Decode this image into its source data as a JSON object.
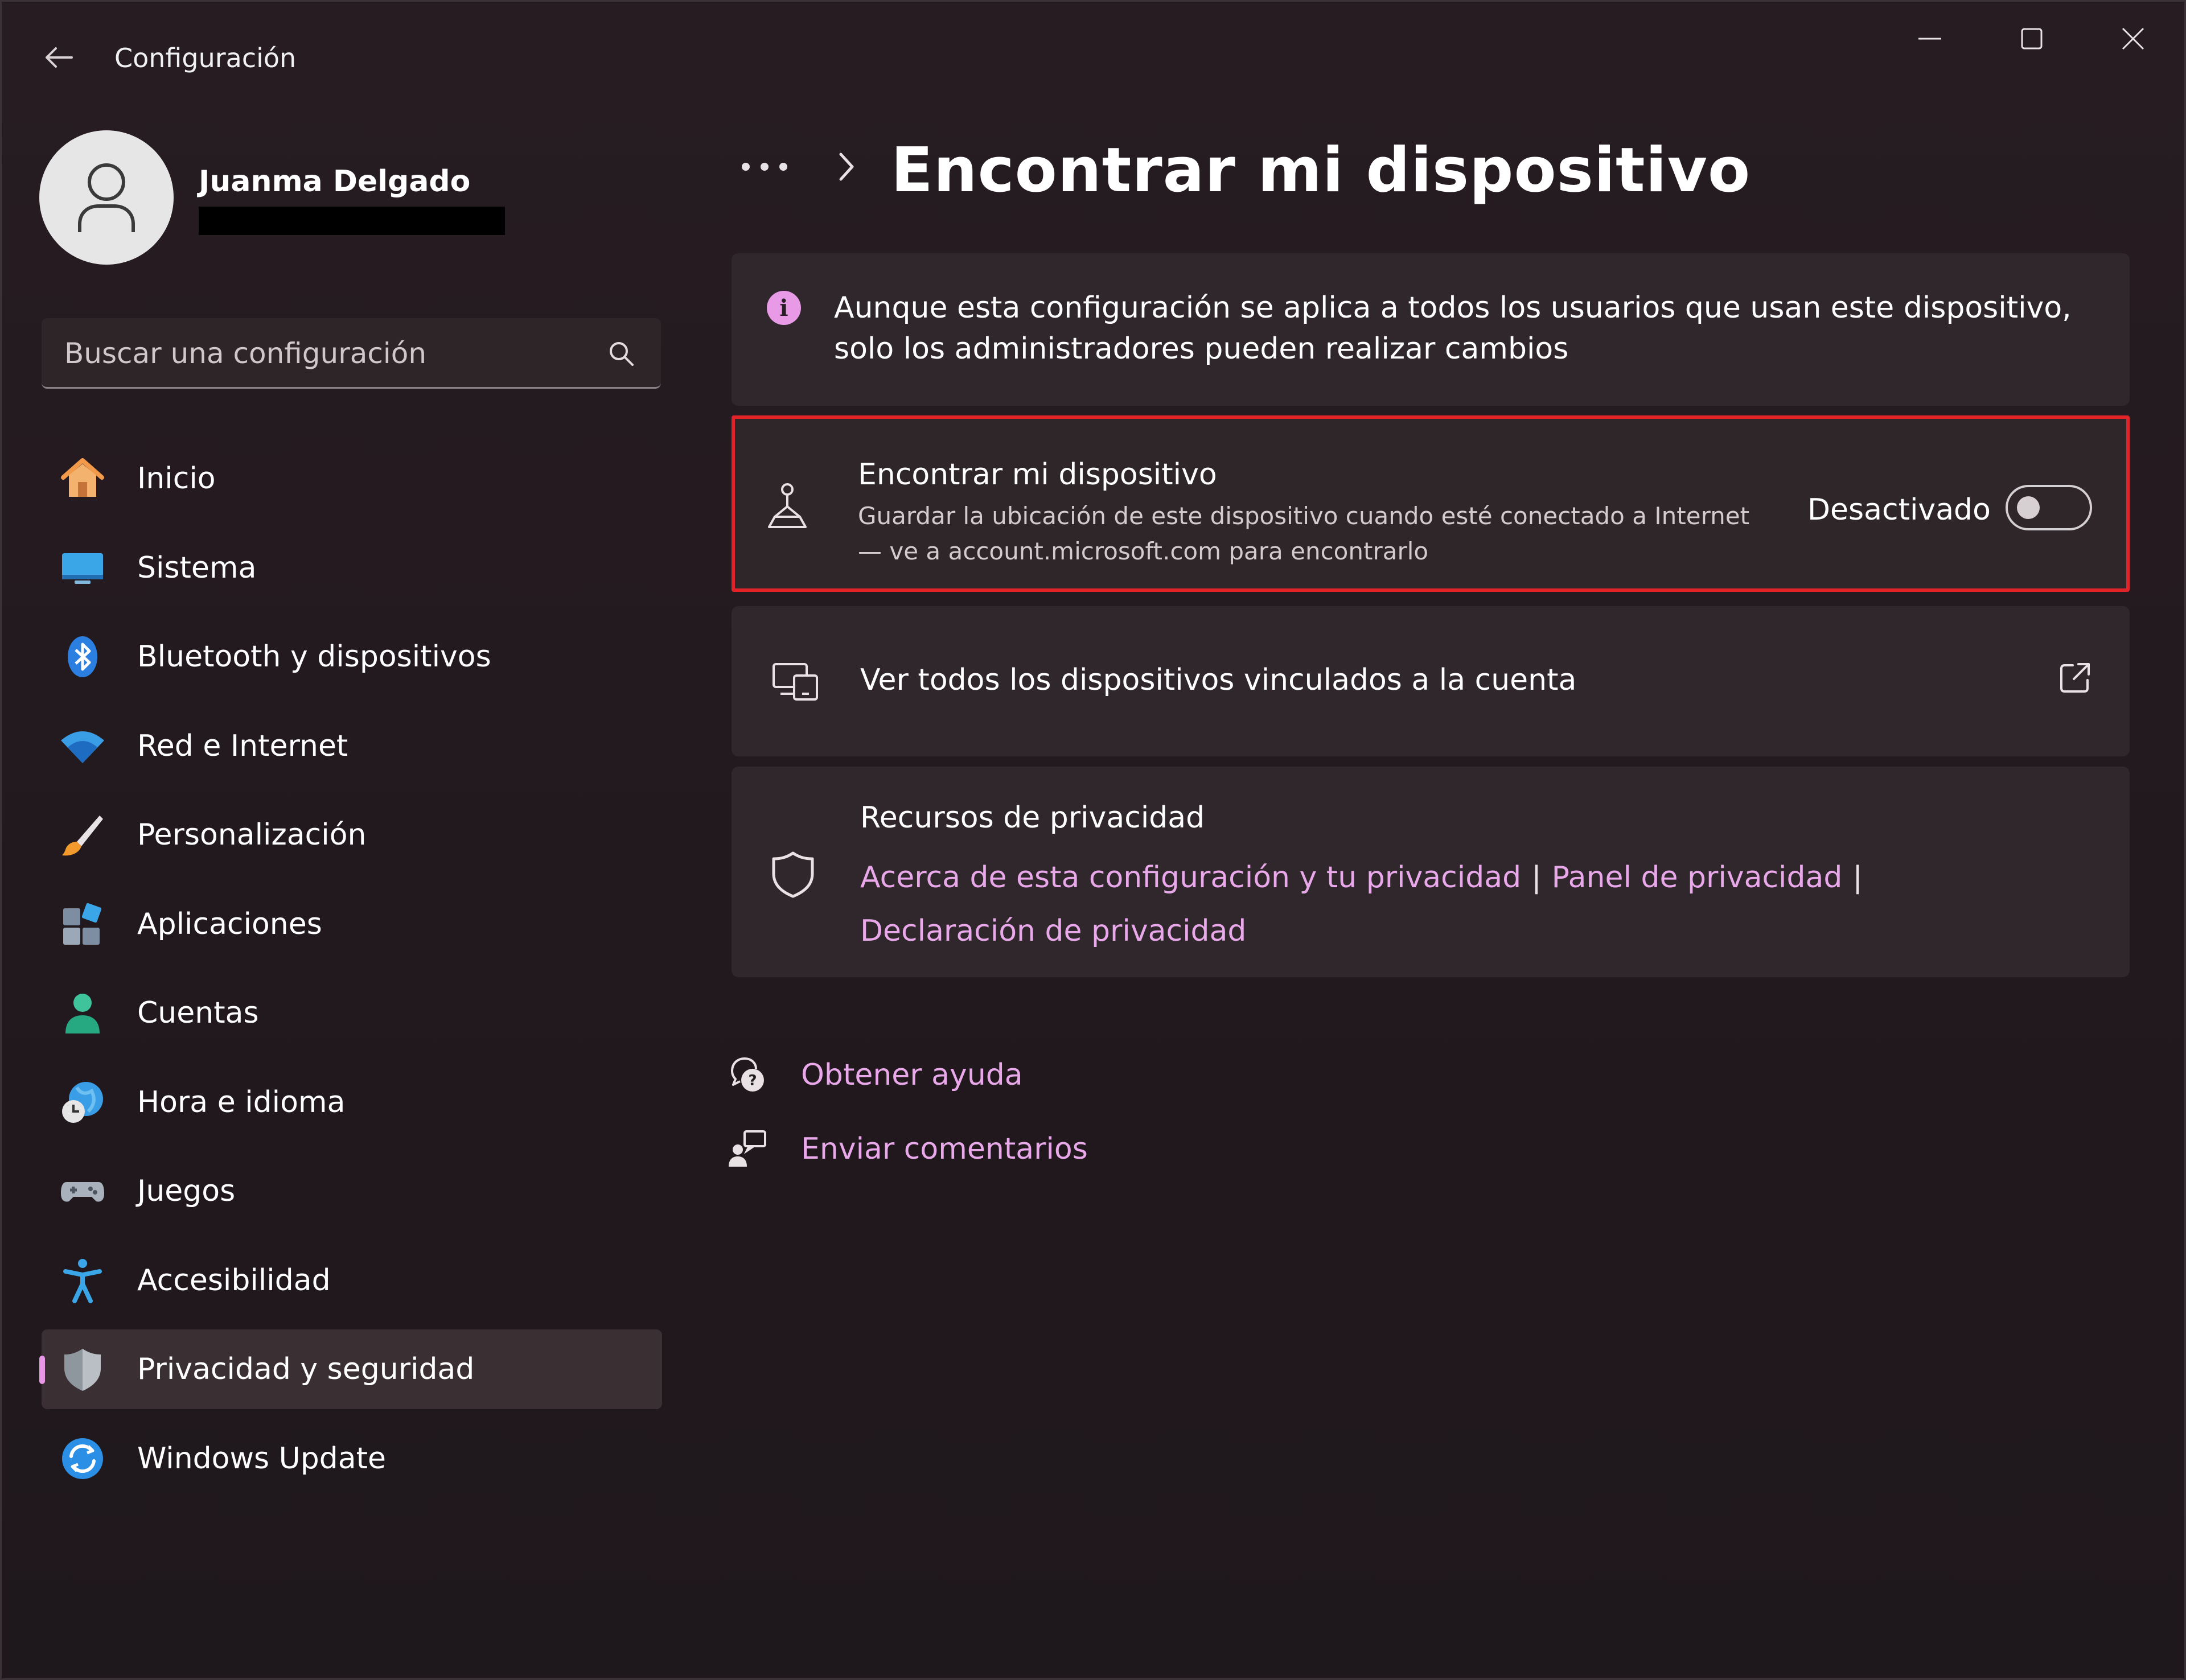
{
  "window": {
    "title": "Configuración",
    "controls": [
      "minimize",
      "maximize",
      "close"
    ]
  },
  "profile": {
    "name": "Juanma Delgado"
  },
  "search": {
    "placeholder": "Buscar una configuración"
  },
  "sidebar": {
    "items": [
      {
        "label": "Inicio",
        "icon": "home-icon"
      },
      {
        "label": "Sistema",
        "icon": "monitor-icon"
      },
      {
        "label": "Bluetooth y dispositivos",
        "icon": "bluetooth-icon"
      },
      {
        "label": "Red e Internet",
        "icon": "wifi-icon"
      },
      {
        "label": "Personalización",
        "icon": "brush-icon"
      },
      {
        "label": "Aplicaciones",
        "icon": "apps-icon"
      },
      {
        "label": "Cuentas",
        "icon": "account-icon"
      },
      {
        "label": "Hora e idioma",
        "icon": "globe-clock-icon"
      },
      {
        "label": "Juegos",
        "icon": "gamepad-icon"
      },
      {
        "label": "Accesibilidad",
        "icon": "accessibility-icon"
      },
      {
        "label": "Privacidad y seguridad",
        "icon": "shield-icon",
        "selected": true
      },
      {
        "label": "Windows Update",
        "icon": "update-icon"
      }
    ]
  },
  "main": {
    "breadcrumb_more": "•••",
    "title": "Encontrar mi dispositivo",
    "info": {
      "text": "Aunque esta configuración se aplica a todos los usuarios que usan este dispositivo, solo los administradores pueden realizar cambios"
    },
    "find_device": {
      "title": "Encontrar mi dispositivo",
      "description_line1": "Guardar la ubicación de este dispositivo cuando esté conectado a Internet",
      "description_line2": "— ve a account.microsoft.com para encontrarlo",
      "status": "Desactivado",
      "toggle_on": false
    },
    "linked_devices": {
      "label": "Ver todos los dispositivos vinculados a la cuenta"
    },
    "privacy": {
      "title": "Recursos de privacidad",
      "link_about": "Acerca de esta configuración y tu privacidad",
      "link_dashboard": "Panel de privacidad",
      "link_statement": "Declaración de privacidad",
      "separator": "|"
    },
    "help": {
      "get_help": "Obtener ayuda",
      "feedback": "Enviar comentarios"
    }
  },
  "colors": {
    "accent_link": "#e8a8ea",
    "highlight_border": "#e0242a",
    "selection_indicator": "#e896e6"
  }
}
